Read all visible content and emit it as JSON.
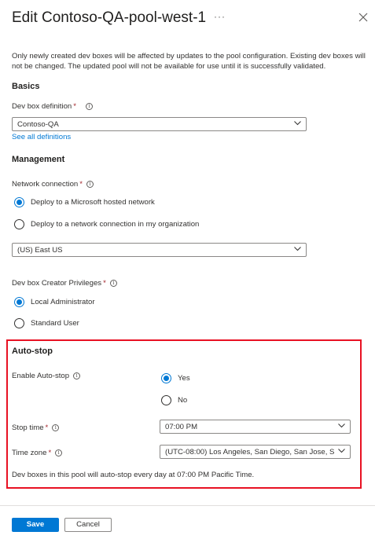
{
  "panel": {
    "title": "Edit Contoso-QA-pool-west-1",
    "more_label": "···",
    "info_text": "Only newly created dev boxes will be affected by updates to the pool configuration. Existing dev boxes will not be changed. The updated pool will not be available for use until it is successfully validated."
  },
  "basics": {
    "heading": "Basics",
    "definition_label": "Dev box definition",
    "definition_value": "Contoso-QA",
    "see_all_link": "See all definitions"
  },
  "management": {
    "heading": "Management",
    "network_label": "Network connection",
    "network_options": [
      {
        "label": "Deploy to a Microsoft hosted network",
        "checked": true
      },
      {
        "label": "Deploy to a network connection in my organization",
        "checked": false
      }
    ],
    "region_value": "(US) East US",
    "privileges_label": "Dev box Creator Privileges",
    "privilege_options": [
      {
        "label": "Local Administrator",
        "checked": true
      },
      {
        "label": "Standard User",
        "checked": false
      }
    ]
  },
  "autostop": {
    "heading": "Auto-stop",
    "enable_label": "Enable Auto-stop",
    "enable_options": [
      {
        "label": "Yes",
        "checked": true
      },
      {
        "label": "No",
        "checked": false
      }
    ],
    "stop_time_label": "Stop time",
    "stop_time_value": "07:00 PM",
    "time_zone_label": "Time zone",
    "time_zone_value": "(UTC-08:00) Los Angeles, San Diego, San Jose, S...",
    "summary": "Dev boxes in this pool will auto-stop every day at 07:00 PM Pacific Time."
  },
  "footer": {
    "save_label": "Save",
    "cancel_label": "Cancel"
  },
  "colors": {
    "accent": "#0078d4",
    "highlight_border": "#e81123",
    "required": "#a4262c"
  },
  "required_marker": "*",
  "info_glyph": "i"
}
